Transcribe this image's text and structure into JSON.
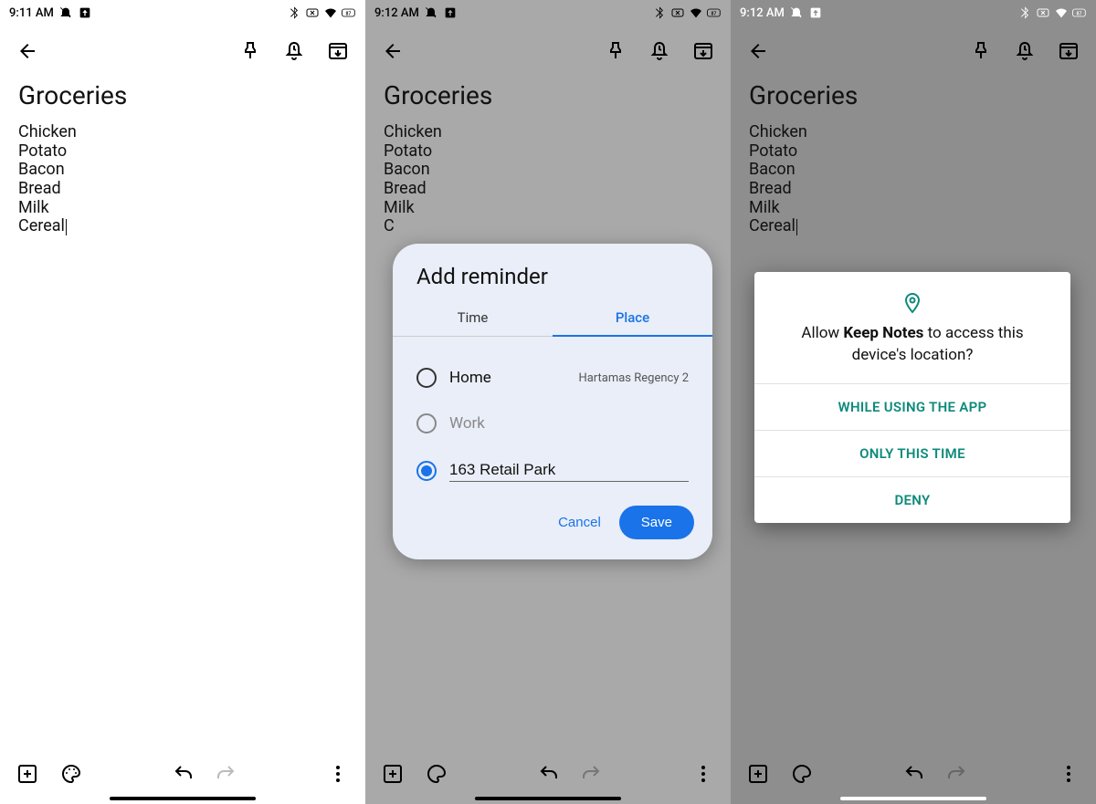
{
  "status": {
    "time1": "9:11 AM",
    "time2": "9:12 AM",
    "time3": "9:12 AM",
    "battery": "87"
  },
  "note": {
    "title": "Groceries",
    "lines": [
      "Chicken",
      "Potato",
      "Bacon",
      "Bread",
      "Milk",
      "Cereal"
    ],
    "lines_partial": [
      "Chicken",
      "Potato",
      "Bacon",
      "Bread",
      "Milk",
      "C"
    ]
  },
  "reminder_dialog": {
    "title": "Add reminder",
    "tab_time": "Time",
    "tab_place": "Place",
    "home_label": "Home",
    "home_sub": "Hartamas Regency 2",
    "work_label": "Work",
    "input_value": "163 Retail Park",
    "cancel": "Cancel",
    "save": "Save"
  },
  "permission_dialog": {
    "msg_pre": "Allow ",
    "app": "Keep Notes",
    "msg_post": " to access this device's location?",
    "while": "WHILE USING THE APP",
    "once": "ONLY THIS TIME",
    "deny": "DENY"
  },
  "colors": {
    "accent_blue": "#1a73e8",
    "accent_teal": "#0d8a7a"
  }
}
